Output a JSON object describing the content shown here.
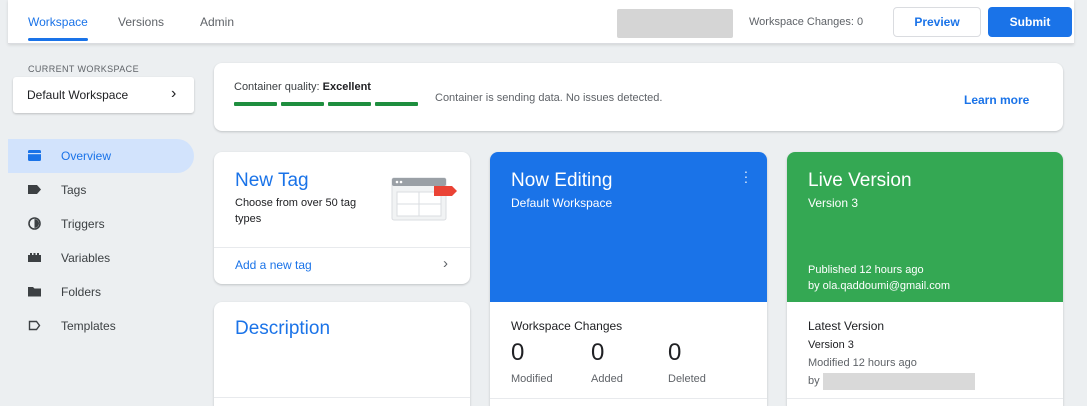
{
  "header": {
    "tabs": [
      {
        "label": "Workspace"
      },
      {
        "label": "Versions"
      },
      {
        "label": "Admin"
      }
    ],
    "workspace_changes": "Workspace Changes: 0",
    "preview_label": "Preview",
    "submit_label": "Submit"
  },
  "sidebar": {
    "current_workspace_label": "CURRENT WORKSPACE",
    "workspace_name": "Default Workspace",
    "items": [
      {
        "label": "Overview",
        "icon": "overview-icon"
      },
      {
        "label": "Tags",
        "icon": "tag-icon"
      },
      {
        "label": "Triggers",
        "icon": "trigger-icon"
      },
      {
        "label": "Variables",
        "icon": "variables-icon"
      },
      {
        "label": "Folders",
        "icon": "folder-icon"
      },
      {
        "label": "Templates",
        "icon": "template-icon"
      }
    ]
  },
  "quality": {
    "label": "Container quality:",
    "value": "Excellent",
    "status": "Container is sending data. No issues detected.",
    "learn_more": "Learn more"
  },
  "new_tag": {
    "title": "New Tag",
    "subtitle": "Choose from over 50 tag types",
    "add_link": "Add a new tag"
  },
  "description": {
    "title": "Description"
  },
  "now_editing": {
    "title": "Now Editing",
    "workspace": "Default Workspace",
    "changes_label": "Workspace Changes",
    "stats": [
      {
        "value": "0",
        "label": "Modified"
      },
      {
        "value": "0",
        "label": "Added"
      },
      {
        "value": "0",
        "label": "Deleted"
      }
    ]
  },
  "live_version": {
    "title": "Live Version",
    "version": "Version 3",
    "published": "Published 12 hours ago",
    "published_by": "by ola.qaddoumi@gmail.com",
    "latest_label": "Latest Version",
    "latest_version": "Version 3",
    "modified": "Modified 12 hours ago",
    "by": "by"
  },
  "colors": {
    "accent": "#1a73e8",
    "live_green": "#34a853",
    "quality_green": "#1e8e3e",
    "active_nav_bg": "#d2e3fc"
  }
}
